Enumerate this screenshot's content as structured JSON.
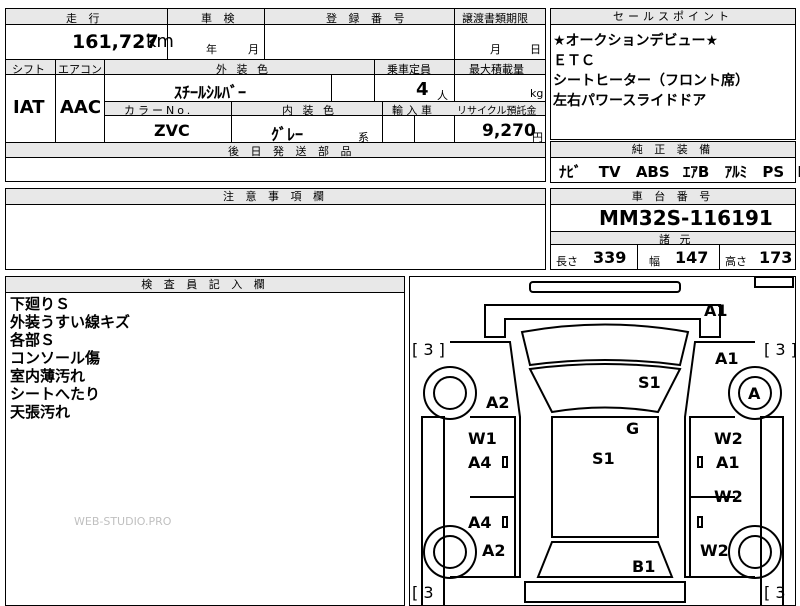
{
  "top_header": {
    "mileage_label": "走 行",
    "inspection_label": "車 検",
    "registration_label": "登 録 番 号",
    "transfer_deadline_label": "譲渡書類期限",
    "sales_point_label": "セールスポイント"
  },
  "vehicle": {
    "mileage": "161,727",
    "mileage_unit": "km",
    "inspection_year_unit": "年",
    "inspection_month_unit": "月",
    "transfer_month_unit": "月",
    "transfer_day_unit": "日",
    "shift_label": "シフト",
    "aircon_label": "エアコン",
    "exterior_color_label": "外 装 色",
    "capacity_label": "乗車定員",
    "max_load_label": "最大積載量",
    "shift_value": "IAT",
    "aircon_value": "AAC",
    "exterior_color": "ｽﾁｰﾙｼﾙﾊﾞｰ",
    "capacity": "4",
    "capacity_unit": "人",
    "max_load_unit": "kg",
    "color_no_label": "カラーNo.",
    "interior_color_label": "内 装 色",
    "import_label": "輸 入 車",
    "recycle_label": "リサイクル預託金",
    "color_no": "ZVC",
    "interior_color": "ｸﾞﾚｰ",
    "interior_color_suffix": "系",
    "recycle_fee": "9,270",
    "recycle_unit": "円",
    "later_parts_label": "後 日 発 送 部 品"
  },
  "sales_points": {
    "items": [
      "★オークションデビュー★",
      "ＥＴＣ",
      "シートヒーター（フロント席）",
      "左右パワースライドドア"
    ]
  },
  "equipment": {
    "label": "純 正 装 備",
    "items": [
      "ﾅﾋﾞ",
      "TV",
      "ABS",
      "ｴｱB",
      "ｱﾙﾐ",
      "PS",
      "PW"
    ]
  },
  "notes_section": {
    "label": "注 意 事 項 欄"
  },
  "chassis": {
    "label": "車 台 番 号",
    "number": "MM32S-116191",
    "specs_label": "諸 元",
    "length_label": "長さ",
    "length": "339",
    "width_label": "幅",
    "width": "147",
    "height_label": "高さ",
    "height": "173"
  },
  "inspector": {
    "label": "検 査 員 記 入 欄",
    "notes": [
      "下廻りＳ",
      "外装うすい線キズ",
      "各部Ｓ",
      "コンソール傷",
      "室内薄汚れ",
      "シートへたり",
      "天張汚れ"
    ]
  },
  "watermark": "WEB-STUDIO.PRO",
  "diagram": {
    "marks": [
      "A1",
      "A1",
      "S1",
      "A",
      "A2",
      "G",
      "W1",
      "A4",
      "S1",
      "W2",
      "A1",
      "W2",
      "A4",
      "A2",
      "W2",
      "B1"
    ],
    "tire_left_top": "[ 3 ]",
    "tire_right_top": "[ 3 ]",
    "tire_left_bottom": "[ 3",
    "tire_right_bottom": "[ 3"
  }
}
